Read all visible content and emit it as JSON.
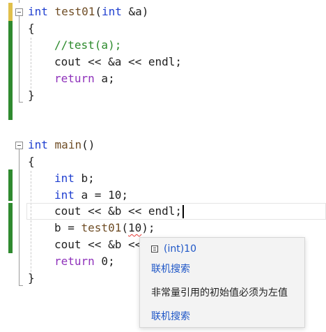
{
  "code": {
    "func1": {
      "signature_kw": "int",
      "signature_name": "test01",
      "signature_params_open": "(",
      "signature_param_kw": "int",
      "signature_param_rest": " &a)",
      "brace_open": "{",
      "comment": "//test(a);",
      "cout_line": "cout << &a << endl;",
      "return_kw": "return",
      "return_rest": " a;",
      "brace_close": "}"
    },
    "main": {
      "signature_kw": "int",
      "signature_name": "main",
      "signature_rest": "()",
      "brace_open": "{",
      "line1_kw": "int",
      "line1_rest": " b;",
      "line2_kw": "int",
      "line2_rest": " a = 10;",
      "line3": "cout << &b << endl;",
      "line4_pre": "b = ",
      "line4_fn": "test01",
      "line4_open": "(",
      "line4_err": "10",
      "line4_close": ");",
      "line5": "cout << &b <<",
      "return_kw": "return",
      "return_rest": " 0;",
      "brace_close": "}"
    }
  },
  "tooltip": {
    "type_label": "(int)10",
    "search_link_1": "联机搜索",
    "error_message": "非常量引用的初始值必须为左值",
    "search_link_2": "联机搜索"
  }
}
